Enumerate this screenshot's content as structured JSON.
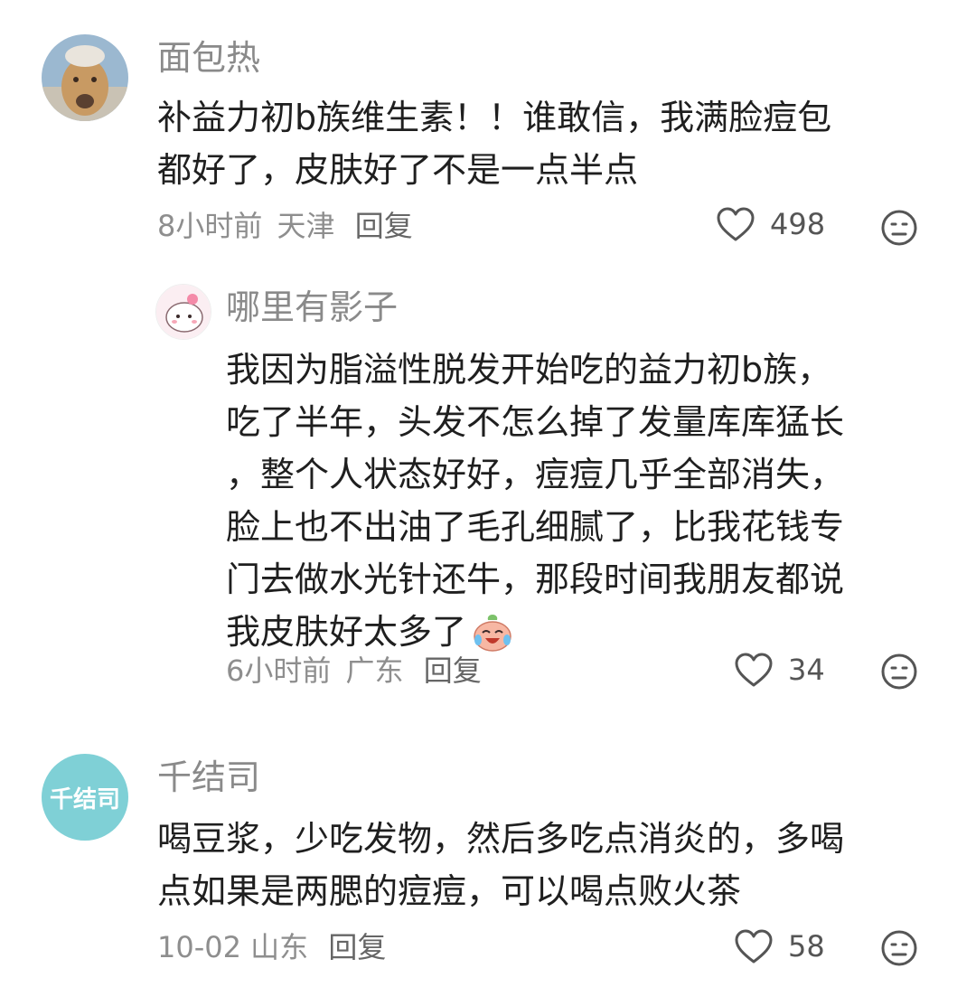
{
  "comments": [
    {
      "username": "面包热",
      "lines": [
        "补益力初b族维生素！！谁敢信，我满脸痘包",
        "都好了，皮肤好了不是一点半点"
      ],
      "time": "8小时前",
      "location": "天津",
      "reply_label": "回复",
      "likes": "498"
    },
    {
      "username": "哪里有影子",
      "lines": [
        "我因为脂溢性脱发开始吃的益力初b族，",
        "吃了半年，头发不怎么掉了发量库库猛长",
        "，整个人状态好好，痘痘几乎全部消失，",
        "脸上也不出油了毛孔细腻了，比我花钱专",
        "门去做水光针还牛，那段时间我朋友都说",
        "我皮肤好太多了"
      ],
      "time": "6小时前",
      "location": "广东",
      "reply_label": "回复",
      "likes": "34"
    },
    {
      "username": "千结司",
      "avatar_text": "千结司",
      "lines": [
        "喝豆浆，少吃发物，然后多吃点消炎的，多喝",
        "点如果是两腮的痘痘，可以喝点败火茶"
      ],
      "time": "10-02",
      "location": "山东",
      "reply_label": "回复",
      "likes": "58"
    }
  ],
  "icons": {
    "like": "heart-outline-icon",
    "dislike": "meh-face-icon",
    "crying_laugh": "crying-laugh-emoji"
  },
  "colors": {
    "avatar_teal": "#7fd0d6",
    "text": "#1f1f1f",
    "muted": "#8a8a8a"
  }
}
